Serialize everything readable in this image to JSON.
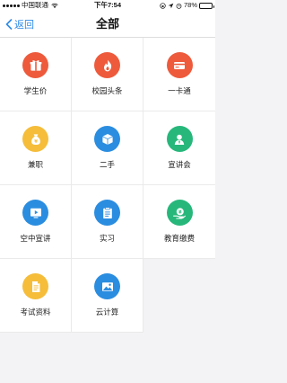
{
  "status_bar": {
    "carrier": "中国联通",
    "time": "下午7:54",
    "battery_percent": "78%",
    "battery_level": 0.78
  },
  "nav": {
    "back_label": "返回",
    "title": "全部"
  },
  "grid": {
    "items": [
      {
        "label": "学生价",
        "icon": "gift-icon",
        "color": "#ee5a3c"
      },
      {
        "label": "校园头条",
        "icon": "flame-icon",
        "color": "#ee5a3c"
      },
      {
        "label": "一卡通",
        "icon": "card-icon",
        "color": "#ee5a3c"
      },
      {
        "label": "兼职",
        "icon": "money-bag-icon",
        "color": "#f5bd3a"
      },
      {
        "label": "二手",
        "icon": "box-icon",
        "color": "#2a8de0"
      },
      {
        "label": "宣讲会",
        "icon": "person-icon",
        "color": "#27b77b"
      },
      {
        "label": "空中宣讲",
        "icon": "play-screen-icon",
        "color": "#2a8de0"
      },
      {
        "label": "实习",
        "icon": "clipboard-icon",
        "color": "#2a8de0"
      },
      {
        "label": "教育缴费",
        "icon": "payment-icon",
        "color": "#27b77b"
      },
      {
        "label": "考试资料",
        "icon": "document-icon",
        "color": "#f5bd3a"
      },
      {
        "label": "云计算",
        "icon": "cloud-image-icon",
        "color": "#2a8de0"
      }
    ]
  }
}
